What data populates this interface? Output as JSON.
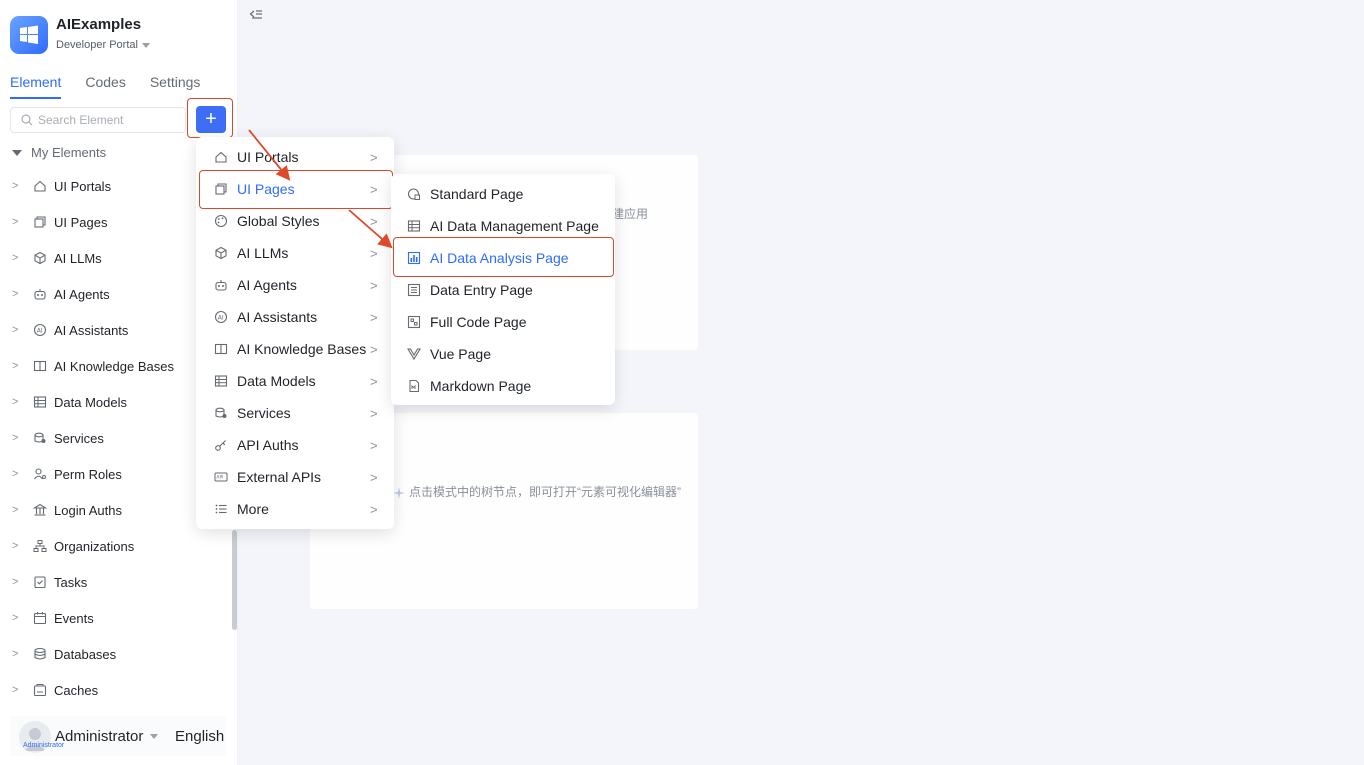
{
  "app": {
    "title": "AIExamples",
    "subtitle": "Developer Portal"
  },
  "tabs": [
    {
      "label": "Element",
      "active": true
    },
    {
      "label": "Codes",
      "active": false
    },
    {
      "label": "Settings",
      "active": false
    }
  ],
  "search": {
    "placeholder": "Search Element"
  },
  "add_button": {
    "label": "+"
  },
  "tree": {
    "root_label": "My Elements",
    "items": [
      {
        "label": "UI Portals",
        "icon": "home-icon"
      },
      {
        "label": "UI Pages",
        "icon": "pages-icon"
      },
      {
        "label": "AI LLMs",
        "icon": "cube-icon"
      },
      {
        "label": "AI Agents",
        "icon": "robot-icon"
      },
      {
        "label": "AI Assistants",
        "icon": "ai-icon"
      },
      {
        "label": "AI Knowledge Bases",
        "icon": "book-icon"
      },
      {
        "label": "Data Models",
        "icon": "table-icon"
      },
      {
        "label": "Services",
        "icon": "services-icon"
      },
      {
        "label": "Perm Roles",
        "icon": "user-roles-icon"
      },
      {
        "label": "Login Auths",
        "icon": "bank-icon"
      },
      {
        "label": "Organizations",
        "icon": "org-icon"
      },
      {
        "label": "Tasks",
        "icon": "task-icon"
      },
      {
        "label": "Events",
        "icon": "calendar-icon"
      },
      {
        "label": "Databases",
        "icon": "database-icon"
      },
      {
        "label": "Caches",
        "icon": "cache-icon"
      }
    ]
  },
  "user": {
    "name": "Administrator",
    "avatar_label": "Administrator",
    "language": "English"
  },
  "main": {
    "hint_top": "建应用",
    "hint_bottom": "点击模式中的树节点，即可打开“元素可视化编辑器”"
  },
  "menu": {
    "items": [
      {
        "label": "UI Portals",
        "icon": "home-icon",
        "active": false
      },
      {
        "label": "UI Pages",
        "icon": "pages-icon",
        "active": true
      },
      {
        "label": "Global Styles",
        "icon": "palette-icon",
        "active": false
      },
      {
        "label": "AI LLMs",
        "icon": "cube-icon",
        "active": false
      },
      {
        "label": "AI Agents",
        "icon": "robot-icon",
        "active": false
      },
      {
        "label": "AI Assistants",
        "icon": "ai-icon",
        "active": false
      },
      {
        "label": "AI Knowledge Bases",
        "icon": "book-icon",
        "active": false
      },
      {
        "label": "Data Models",
        "icon": "table-icon",
        "active": false
      },
      {
        "label": "Services",
        "icon": "services-icon",
        "active": false
      },
      {
        "label": "API Auths",
        "icon": "key-icon",
        "active": false
      },
      {
        "label": "External APIs",
        "icon": "api-icon",
        "active": false
      },
      {
        "label": "More",
        "icon": "list-icon",
        "active": false
      }
    ]
  },
  "submenu": {
    "items": [
      {
        "label": "Standard Page",
        "icon": "standard-page-icon",
        "active": false
      },
      {
        "label": "AI Data Management Page",
        "icon": "table-icon",
        "active": false
      },
      {
        "label": "AI Data Analysis Page",
        "icon": "bar-chart-icon",
        "active": true
      },
      {
        "label": "Data Entry Page",
        "icon": "form-icon",
        "active": false
      },
      {
        "label": "Full Code Page",
        "icon": "code-icon",
        "active": false
      },
      {
        "label": "Vue Page",
        "icon": "vue-icon",
        "active": false
      },
      {
        "label": "Markdown Page",
        "icon": "markdown-icon",
        "active": false
      }
    ]
  },
  "colors": {
    "accent": "#2f6bff",
    "highlight": "#d94a2b",
    "arrow": "#e04a2a"
  }
}
